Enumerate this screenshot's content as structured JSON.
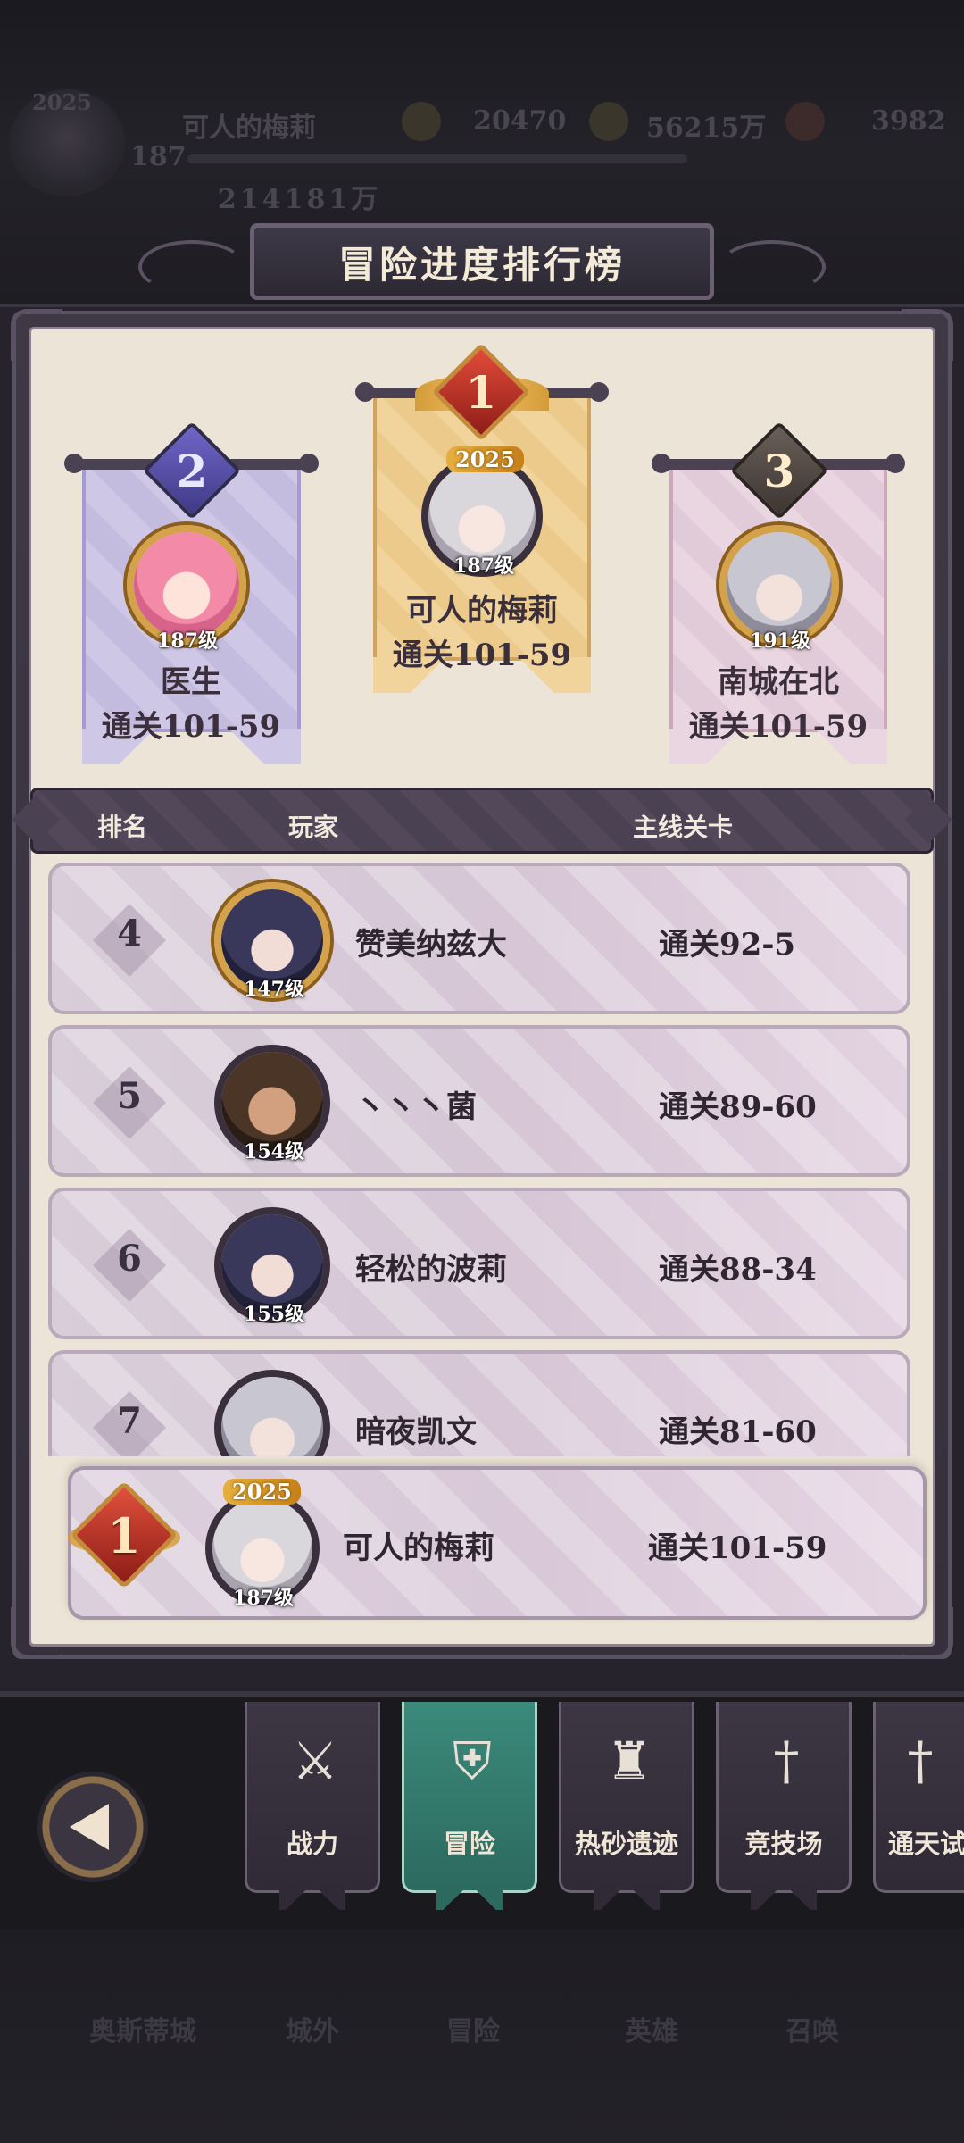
{
  "hud": {
    "player_name": "可人的梅莉",
    "level": "187",
    "year_badge": "2025",
    "power": "214181万",
    "currency1": "20470",
    "currency2": "56215万",
    "currency3": "3982"
  },
  "leaderboard": {
    "title": "冒险进度排行榜",
    "podium": [
      {
        "rank": "1",
        "name": "可人的梅莉",
        "stage": "通关101-59",
        "level": "187级",
        "badge": "2025"
      },
      {
        "rank": "2",
        "name": "医生",
        "stage": "通关101-59",
        "level": "187级"
      },
      {
        "rank": "3",
        "name": "南城在北",
        "stage": "通关101-59",
        "level": "191级"
      }
    ],
    "columns": {
      "rank": "排名",
      "player": "玩家",
      "stage": "主线关卡"
    },
    "rows": [
      {
        "rank": "4",
        "name": "赞美纳兹大",
        "stage": "通关92-5",
        "level": "147级"
      },
      {
        "rank": "5",
        "name": "丶丶丶菌",
        "stage": "通关89-60",
        "level": "154级"
      },
      {
        "rank": "6",
        "name": "轻松的波莉",
        "stage": "通关88-34",
        "level": "155级"
      },
      {
        "rank": "7",
        "name": "暗夜凯文",
        "stage": "通关81-60",
        "level": ""
      }
    ],
    "self": {
      "rank": "1",
      "name": "可人的梅莉",
      "stage": "通关101-59",
      "level": "187级",
      "badge": "2025"
    }
  },
  "tabs": [
    {
      "label": "战力",
      "icon": "crossed-swords-icon",
      "active": false
    },
    {
      "label": "冒险",
      "icon": "shield-sword-icon",
      "active": true
    },
    {
      "label": "热砂遗迹",
      "icon": "tower-icon",
      "active": false
    },
    {
      "label": "竞技场",
      "icon": "sword-pedestal-icon",
      "active": false
    },
    {
      "label": "通天试",
      "icon": "sword-spire-icon",
      "active": false
    }
  ],
  "bg_nav": [
    "奥斯蒂城",
    "城外",
    "冒险",
    "英雄",
    "召唤"
  ],
  "colors": {
    "accent_teal": "#3b8a7b",
    "panel_dark": "#3f3946",
    "paper": "#ece4d6",
    "gold": "#d4a24a"
  }
}
